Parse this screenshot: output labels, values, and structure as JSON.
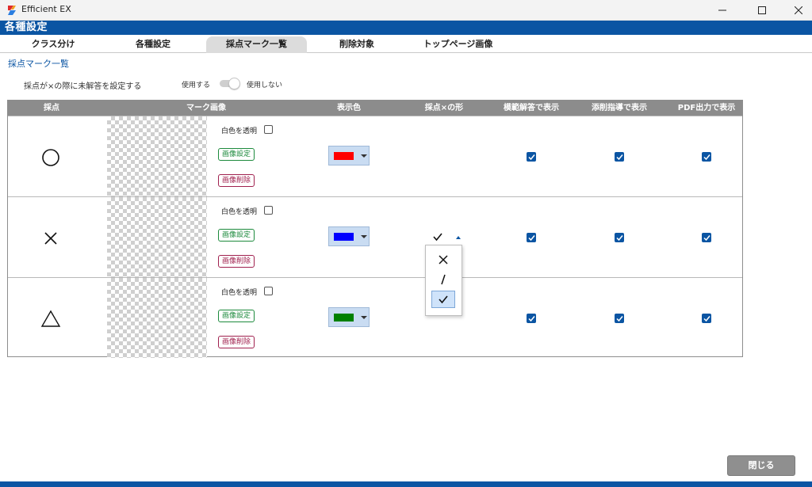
{
  "window": {
    "title": "Efficient EX"
  },
  "header": {
    "title": "各種設定"
  },
  "tabs": [
    {
      "label": "クラス分け"
    },
    {
      "label": "各種設定"
    },
    {
      "label": "採点マーク一覧"
    },
    {
      "label": "削除対象"
    },
    {
      "label": "トップページ画像"
    }
  ],
  "active_tab": "採点マーク一覧",
  "section": {
    "title": "採点マーク一覧"
  },
  "setting": {
    "label": "採点が×の際に未解答を設定する",
    "option_on": "使用する",
    "option_off": "使用しない",
    "state": "使用しない"
  },
  "grid": {
    "columns": [
      "採点",
      "マーク画像",
      "表示色",
      "採点×の形",
      "模範解答で表示",
      "添削指導で表示",
      "PDF出力で表示"
    ],
    "transparent_label": "白色を透明",
    "image_set_label": "画像設定",
    "image_delete_label": "画像削除",
    "rows": [
      {
        "mark": "circle-icon",
        "color": "#ff0000",
        "transparent": false,
        "model": true,
        "correction": true,
        "pdf": true
      },
      {
        "mark": "cross-icon",
        "color": "#0000ff",
        "transparent": false,
        "model": true,
        "correction": true,
        "pdf": true,
        "shape": "check"
      },
      {
        "mark": "triangle-icon",
        "color": "#008000",
        "transparent": false,
        "model": true,
        "correction": true,
        "pdf": true
      }
    ]
  },
  "shape_popup": {
    "options": [
      "cross-icon",
      "slash-icon",
      "check-icon"
    ],
    "selected": "check-icon"
  },
  "footer": {
    "close_label": "閉じる"
  },
  "colors": {
    "accent": "#0b55a3",
    "header_gray": "#8c8c8c"
  }
}
